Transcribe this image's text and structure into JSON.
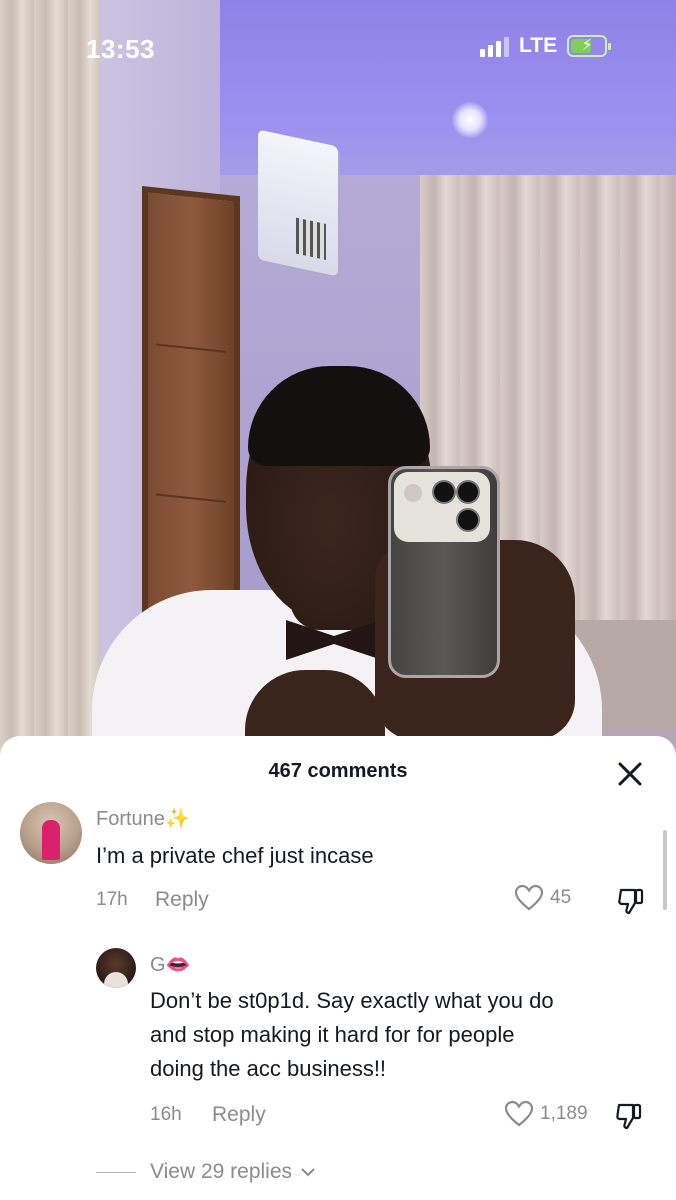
{
  "status_bar": {
    "time": "13:53",
    "network": "LTE",
    "battery_icon": "battery-charging-icon"
  },
  "photo": {
    "description_icon": "video-background"
  },
  "comments_sheet": {
    "title": "467 comments",
    "close_icon": "close-icon",
    "comments": [
      {
        "username": "Fortune",
        "username_decoration": "✨",
        "text": "I’m a private chef just incase",
        "age": "17h",
        "reply_label": "Reply",
        "likes": "45"
      },
      {
        "username": "G",
        "username_decoration": "👄",
        "text_lines": [
          "Don’t be st0p1d. Say exactly what you do",
          "and stop making it hard for for people",
          "doing the acc business!!"
        ],
        "age": "16h",
        "reply_label": "Reply",
        "likes": "1,189"
      }
    ],
    "view_replies_label": "View 29 replies"
  },
  "colors": {
    "text_primary": "#161823",
    "text_secondary": "#8a8b91",
    "sheet_background": "#ffffff"
  }
}
